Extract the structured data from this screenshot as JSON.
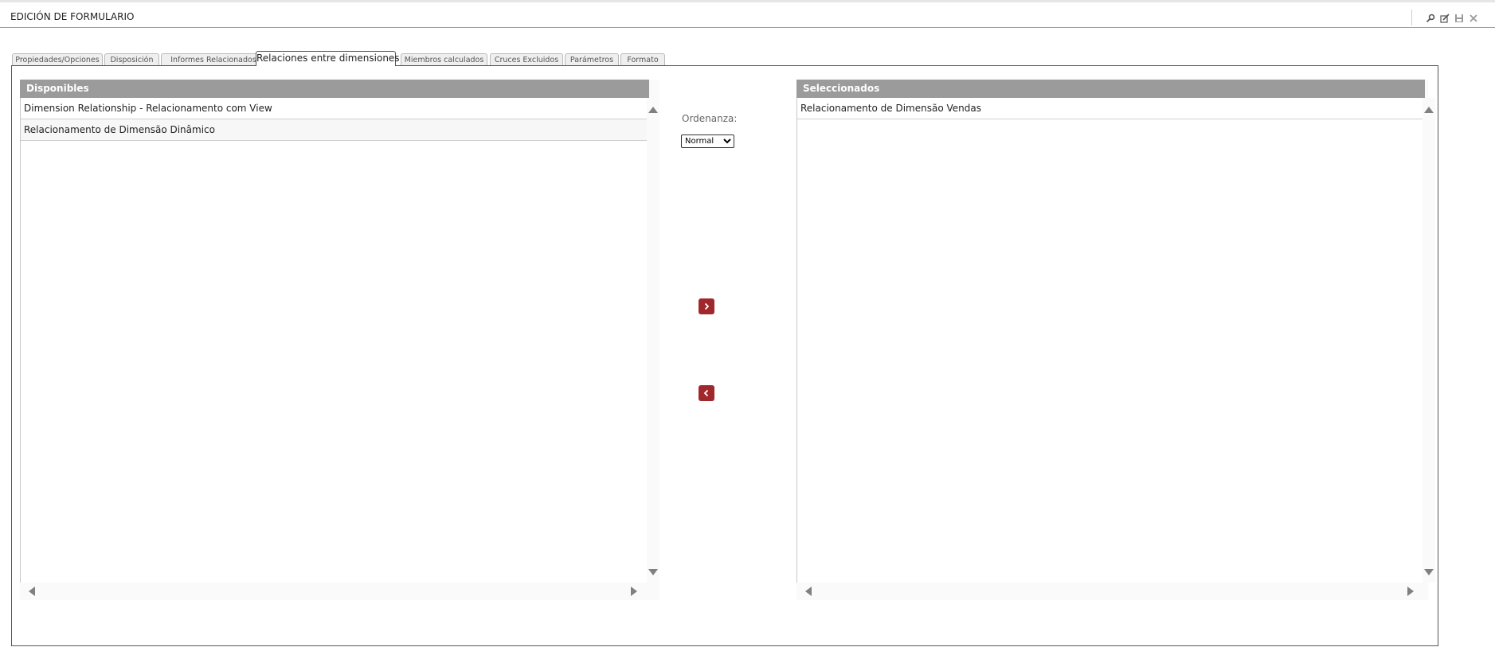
{
  "window": {
    "title": "EDICIÓN DE FORMULARIO",
    "toolbar_icons": [
      "pin-icon",
      "edit-icon",
      "save-icon",
      "close-icon"
    ]
  },
  "tabs": [
    {
      "label": "Propiedades/Opciones",
      "active": false
    },
    {
      "label": "Disposición",
      "active": false
    },
    {
      "label": "Informes Relacionados",
      "active": false
    },
    {
      "label": "Relaciones entre dimensiones",
      "active": true
    },
    {
      "label": "Miembros calculados",
      "active": false
    },
    {
      "label": "Cruces Excluidos",
      "active": false
    },
    {
      "label": "Parámetros",
      "active": false
    },
    {
      "label": "Formato",
      "active": false
    }
  ],
  "available": {
    "header": "Disponibles",
    "items": [
      "Dimension Relationship - Relacionamento com View",
      "Relacionamento de Dimensão Dinâmico"
    ]
  },
  "selected": {
    "header": "Seleccionados",
    "items": [
      "Relacionamento de Dimensão Vendas"
    ]
  },
  "ordering": {
    "label": "Ordenanza:",
    "value": "Normal"
  },
  "colors": {
    "header_bg": "#9b9b9b",
    "button_bg": "#a0282d"
  }
}
